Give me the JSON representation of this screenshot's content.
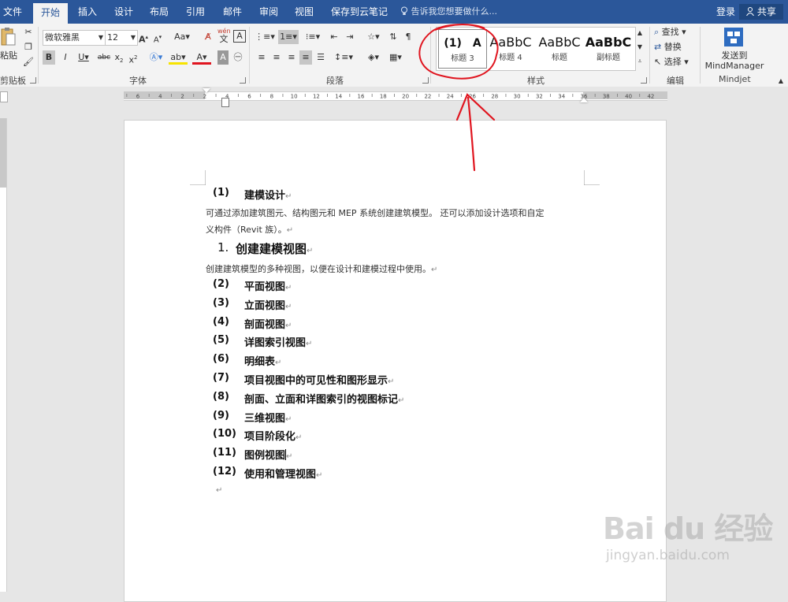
{
  "tabs": [
    {
      "label": "文件"
    },
    {
      "label": "开始"
    },
    {
      "label": "插入"
    },
    {
      "label": "设计"
    },
    {
      "label": "布局"
    },
    {
      "label": "引用"
    },
    {
      "label": "邮件"
    },
    {
      "label": "审阅"
    },
    {
      "label": "视图"
    },
    {
      "label": "保存到云笔记"
    }
  ],
  "tell_me": "告诉我您想要做什么...",
  "login": "登录",
  "share": "共享",
  "ribbon": {
    "paste": "粘贴",
    "clipboard_group": "剪贴板",
    "font_name": "微软雅黑",
    "font_size": "12",
    "phonetic_top": "wén",
    "phonetic_bottom": "文",
    "font_group": "字体",
    "paragraph_group": "段落",
    "style_group": "样式",
    "styles": [
      {
        "preview": "(1)　A",
        "name": "标题 3"
      },
      {
        "preview": "AaBbC",
        "name": "标题 4"
      },
      {
        "preview": "AaBbC",
        "name": "标题"
      },
      {
        "preview": "AaBbC",
        "name": "副标题"
      }
    ],
    "find": "查找",
    "replace": "替换",
    "select": "选择",
    "edit_group": "编辑",
    "send_to": "发送到",
    "mindmanager": "MindManager",
    "mindjet_group": "Mindjet"
  },
  "ruler_labels": [
    "6",
    "4",
    "2",
    "2",
    "4",
    "6",
    "8",
    "10",
    "12",
    "14",
    "16",
    "18",
    "20",
    "22",
    "24",
    "26",
    "28",
    "30",
    "32",
    "34",
    "36",
    "38",
    "40",
    "42"
  ],
  "document": {
    "heading1_num": "(1)",
    "heading1": "建模设计",
    "para1_line1": "可通过添加建筑图元、结构图元和 MEP 系统创建建筑模型。 还可以添加设计选项和自定",
    "para1_line2": "义构件（Revit 族）。",
    "heading2_num": "1.",
    "heading2": "创建建模视图",
    "para2": "创建建筑模型的多种视图，以便在设计和建模过程中使用。",
    "items": [
      {
        "num": "(2)",
        "text": "平面视图"
      },
      {
        "num": "(3)",
        "text": "立面视图"
      },
      {
        "num": "(4)",
        "text": "剖面视图"
      },
      {
        "num": "(5)",
        "text": "详图索引视图"
      },
      {
        "num": "(6)",
        "text": "明细表"
      },
      {
        "num": "(7)",
        "text": "项目视图中的可见性和图形显示"
      },
      {
        "num": "(8)",
        "text": "剖面、立面和详图索引的视图标记"
      },
      {
        "num": "(9)",
        "text": "三维视图"
      },
      {
        "num": "(10)",
        "text": "项目阶段化"
      },
      {
        "num": "(11)",
        "text": "图例视图"
      },
      {
        "num": "(12)",
        "text": "使用和管理视图"
      }
    ]
  },
  "watermark": {
    "brand": "Bai du 经验",
    "url": "jingyan.baidu.com"
  },
  "colors": {
    "accent": "#2b579a",
    "annotation": "#e0151f"
  }
}
